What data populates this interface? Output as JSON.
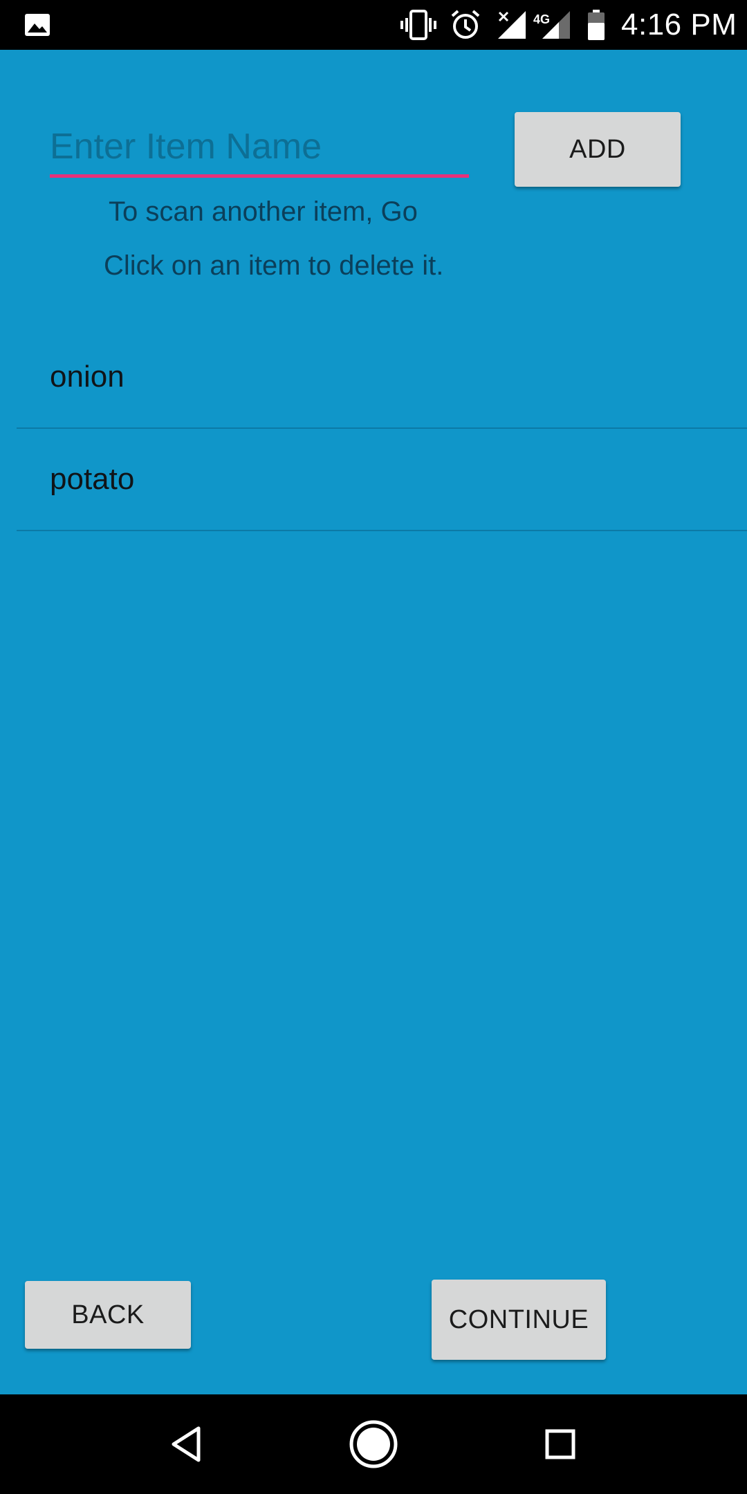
{
  "status_bar": {
    "time": "4:16 PM",
    "left_icons": [
      "image-notification-icon"
    ],
    "right_icons": [
      "vibrate-icon",
      "alarm-icon",
      "signal-no-data-icon",
      "signal-4g-icon",
      "battery-icon"
    ],
    "network_label": "4G"
  },
  "form": {
    "input_placeholder": "Enter Item Name",
    "input_value": "",
    "add_label": "ADD"
  },
  "hints": {
    "scan": "To scan another item, Go",
    "delete": "Click on an item to delete it."
  },
  "items": [
    {
      "label": "onion"
    },
    {
      "label": "potato"
    }
  ],
  "footer": {
    "back_label": "BACK",
    "continue_label": "CONTINUE"
  },
  "nav": {
    "buttons": [
      "back-triangle-icon",
      "home-circle-icon",
      "recents-square-icon"
    ]
  },
  "colors": {
    "background": "#1096c9",
    "accent_underline": "#e8317a",
    "button": "#d6d7d7"
  }
}
